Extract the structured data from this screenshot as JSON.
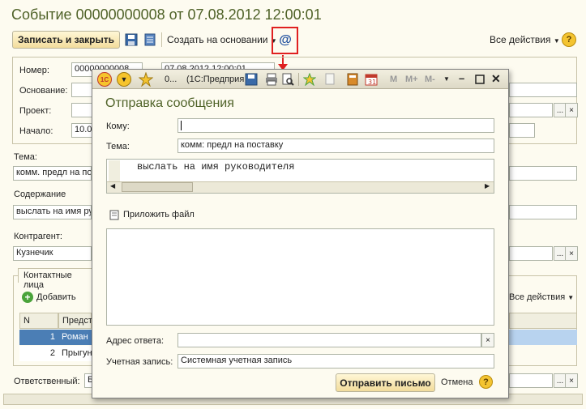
{
  "main": {
    "title": "Событие 00000000008 от 07.08.2012 12:00:01",
    "toolbar": {
      "save_close": "Записать и закрыть",
      "create_basis": "Создать на основании",
      "all_actions": "Все действия",
      "email_glyph": "@",
      "help_glyph": "?"
    },
    "fields": {
      "number_label": "Номер:",
      "number_value": "00000000008",
      "date_value": "07.08.2012 12:00:01",
      "basis_label": "Основание:",
      "project_label": "Проект:",
      "start_label": "Начало:",
      "start_value": "10.0",
      "topic_label": "Тема:",
      "topic_value": "комм. предл на по",
      "content_label": "Содержание",
      "content_value": "выслать на имя ру",
      "contractor_label": "Контрагент:",
      "contractor_value": "Кузнечик",
      "responsible_label": "Ответственный:",
      "responsible_value": "Б"
    },
    "contacts": {
      "tab_label": "Контактные лица",
      "add_label": "Добавить",
      "all_actions": "Все действия",
      "col_n": "N",
      "col_rep": "Предст",
      "rows": [
        {
          "n": "1",
          "name": "Роман"
        },
        {
          "n": "2",
          "name": "Прыгун"
        }
      ]
    }
  },
  "modal": {
    "titlebar": {
      "doc_short": "0...",
      "app_name": "(1С:Предприя",
      "m_label": "M",
      "mplus_label": "M+",
      "mminus_label": "M-"
    },
    "heading": "Отправка сообщения",
    "to_label": "Кому:",
    "to_value": "",
    "subject_label": "Тема:",
    "subject_value": "комм: предл на поставку",
    "body_text": "выслать на имя руководителя",
    "attach_label": "Приложить файл",
    "reply_label": "Адрес ответа:",
    "reply_value": "",
    "account_label": "Учетная запись:",
    "account_value": "Системная учетная запись",
    "send_button": "Отправить письмо",
    "cancel_link": "Отмена",
    "help_glyph": "?"
  },
  "colors": {
    "title_green": "#4f6228",
    "highlight_red": "#e02020",
    "selection_blue": "#4b7eb5"
  }
}
